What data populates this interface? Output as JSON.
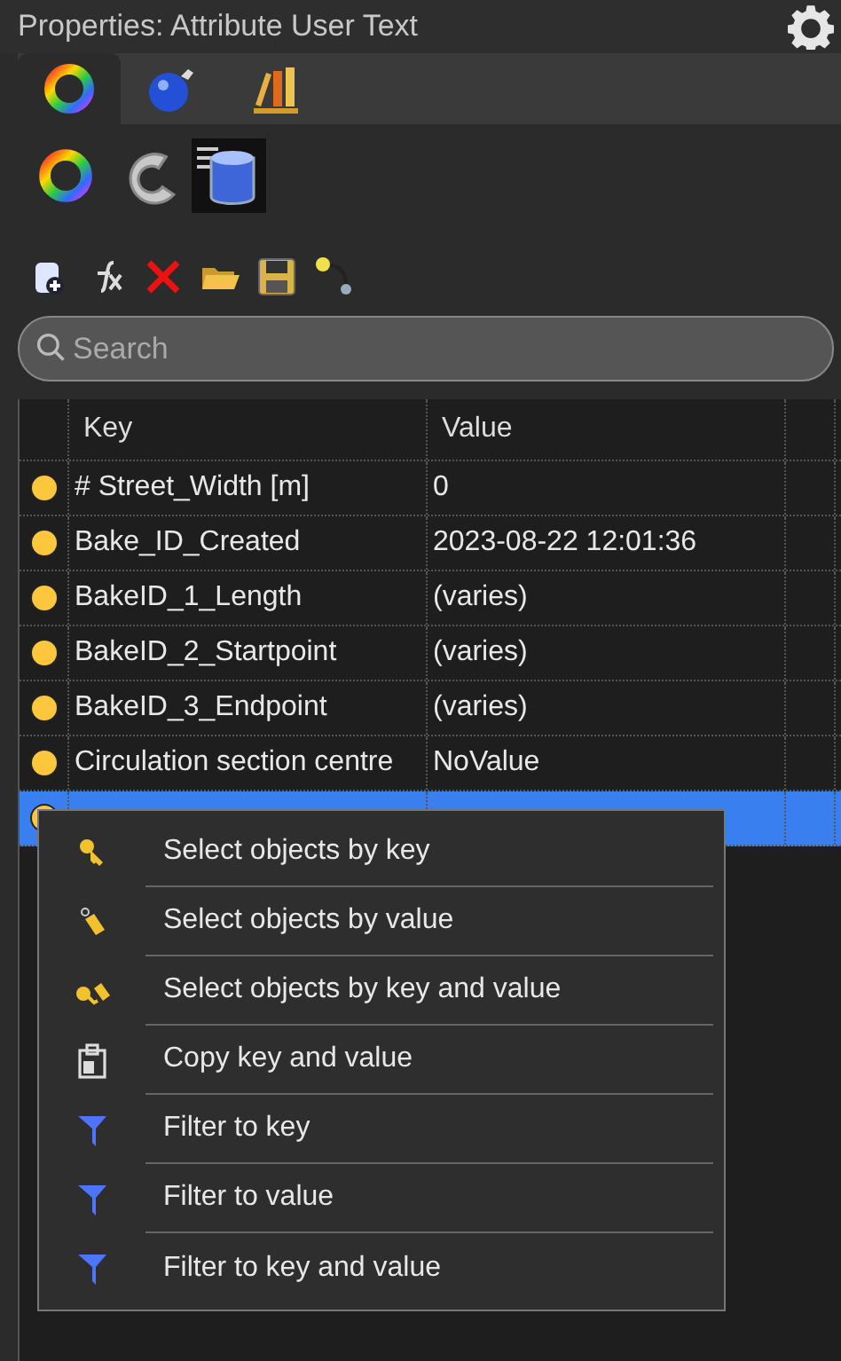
{
  "window": {
    "title": "Properties: Attribute User Text"
  },
  "tabs": [
    {
      "kind": "color",
      "selected": true
    },
    {
      "kind": "bomb",
      "selected": false
    },
    {
      "kind": "books",
      "selected": false
    }
  ],
  "subtabs": [
    {
      "kind": "color",
      "selected": false
    },
    {
      "kind": "curve",
      "selected": false
    },
    {
      "kind": "database",
      "selected": true
    }
  ],
  "search": {
    "placeholder": "Search"
  },
  "table": {
    "columns": [
      "Key",
      "Value"
    ],
    "rows": [
      {
        "key": "# Street_Width [m]",
        "value": "0",
        "selected": false
      },
      {
        "key": "Bake_ID_Created",
        "value": "2023-08-22 12:01:36",
        "selected": false
      },
      {
        "key": "BakeID_1_Length",
        "value": "(varies)",
        "selected": false
      },
      {
        "key": "BakeID_2_Startpoint",
        "value": "(varies)",
        "selected": false
      },
      {
        "key": "BakeID_3_Endpoint",
        "value": "(varies)",
        "selected": false
      },
      {
        "key": "Circulation section centre",
        "value": "NoValue",
        "selected": false
      },
      {
        "selected": true
      }
    ]
  },
  "context_menu": [
    {
      "kind": "key",
      "label": "Select objects by key"
    },
    {
      "kind": "value",
      "label": "Select objects by value"
    },
    {
      "kind": "keyvalue",
      "label": "Select objects by key and value"
    },
    {
      "kind": "copy",
      "label": "Copy key and value"
    },
    {
      "kind": "filter",
      "label": "Filter to key"
    },
    {
      "kind": "filter",
      "label": "Filter to value"
    },
    {
      "kind": "filter",
      "label": "Filter to key and value"
    }
  ]
}
